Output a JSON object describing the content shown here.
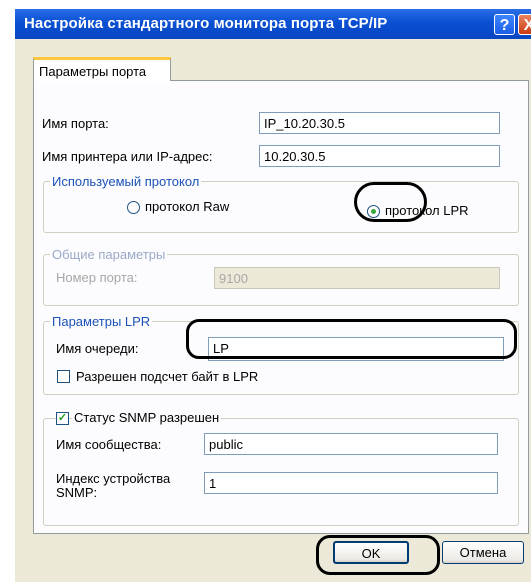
{
  "window": {
    "title": "Настройка стандартного монитора порта TCP/IP",
    "help_button": "?",
    "close_button": "X"
  },
  "tab": {
    "label": "Параметры порта"
  },
  "port_name": {
    "label": "Имя порта:",
    "value": "IP_10.20.30.5"
  },
  "printer_address": {
    "label": "Имя принтера или IP-адрес:",
    "value": "10.20.30.5"
  },
  "protocol": {
    "legend": "Используемый протокол",
    "raw_label": "протокол Raw",
    "lpr_label": "протокол LPR",
    "selected": "протокол LPR"
  },
  "common": {
    "legend": "Общие параметры",
    "port_number_label": "Номер порта:",
    "port_number_value": "9100"
  },
  "lpr": {
    "legend": "Параметры LPR",
    "queue_label": "Имя очереди:",
    "queue_value": "LP",
    "byte_count_label": "Разрешен подсчет байт в LPR",
    "byte_count_checked": false
  },
  "snmp": {
    "enabled_label": "Статус SNMP разрешен",
    "enabled_checked": true,
    "community_label": "Имя сообщества:",
    "community_value": "public",
    "index_label_line1": "Индекс устройства",
    "index_label_line2": "SNMP:",
    "index_value": "1"
  },
  "buttons": {
    "ok": "OK",
    "cancel": "Отмена"
  },
  "colors": {
    "titlebar": "#0a4fd2",
    "dialog_bg": "#ece9d8",
    "group_legend": "#1c52b8",
    "highlight": "#000000"
  }
}
